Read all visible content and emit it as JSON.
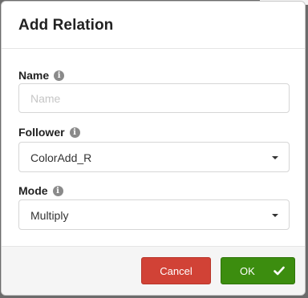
{
  "dialog": {
    "title": "Add Relation"
  },
  "form": {
    "name": {
      "label": "Name",
      "placeholder": "Name",
      "value": ""
    },
    "follower": {
      "label": "Follower",
      "selected": "ColorAdd_R"
    },
    "mode": {
      "label": "Mode",
      "selected": "Multiply"
    },
    "info_glyph": "i"
  },
  "footer": {
    "cancel_label": "Cancel",
    "ok_label": "OK"
  },
  "icons": {
    "info": "info-icon",
    "caret": "caret-down-icon",
    "check": "check-icon"
  },
  "colors": {
    "cancel": "#d14236",
    "ok": "#3c8d0f"
  }
}
